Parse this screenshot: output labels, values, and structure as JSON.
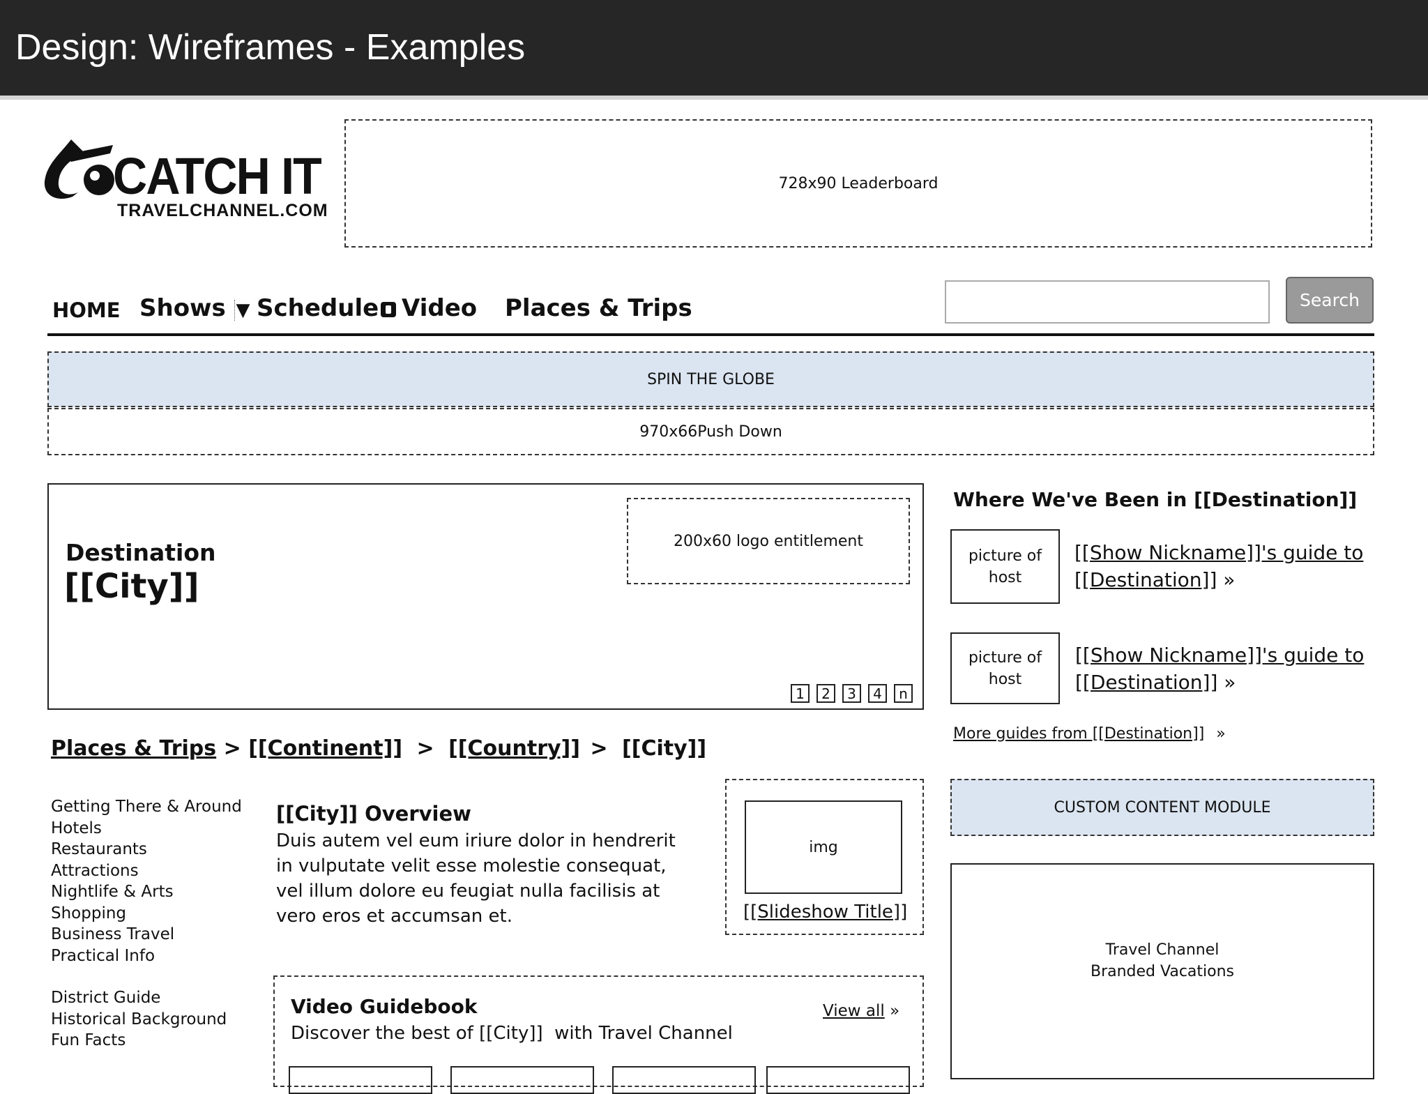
{
  "slide": {
    "title": "Design: Wireframes - Examples"
  },
  "brand": {
    "name": "CATCH IT",
    "domain": "TRAVELCHANNEL.COM"
  },
  "ads": {
    "leaderboard": "728x90 Leaderboard",
    "pushdown": "970x66Push Down",
    "logo_entitlement": "200x60 logo entitlement"
  },
  "nav": {
    "home": "HOME",
    "shows": "Shows",
    "schedule": "Schedule",
    "video": "Video",
    "places": "Places & Trips",
    "search_button": "Search",
    "search_value": ""
  },
  "spin_globe": "SPIN THE GLOBE",
  "hero": {
    "label": "Destination",
    "city": "[[City]]",
    "pages": [
      "1",
      "2",
      "3",
      "4",
      "n"
    ]
  },
  "breadcrumb": {
    "places": "Places & Trips",
    "continent": "[[Continent]]",
    "country": "[[Country]]",
    "city": "[[City]]",
    "sep1": ">",
    "sep2": ">",
    "sep3": ">"
  },
  "side_links": {
    "group1": [
      "Getting There & Around",
      "Hotels",
      "Restaurants",
      "Attractions",
      "Nightlife & Arts",
      "Shopping",
      "Business Travel",
      "Practical Info"
    ],
    "group2": [
      "District Guide",
      "Historical Background",
      "Fun Facts"
    ]
  },
  "overview": {
    "title": "[[City]] Overview",
    "body": "Duis autem vel eum iriure dolor in hendrerit in vulputate velit esse molestie consequat, vel illum dolore eu feugiat nulla facilisis at vero eros et accumsan et."
  },
  "slideshow": {
    "img": "img",
    "title": "[[Slideshow Title]]"
  },
  "video_guidebook": {
    "title": "Video Guidebook",
    "subtitle": "Discover the best of [[City]]  with Travel Channel",
    "view_all": "View all",
    "view_all_arrow": "»"
  },
  "where_been": {
    "heading": "Where We've Been in [[Destination]]",
    "items": [
      {
        "pic_line1": "picture of",
        "pic_line2": "host",
        "link1": "[[Show Nickname]]'s guide to",
        "link2": "[[Destination]]",
        "arrow": "»"
      },
      {
        "pic_line1": "picture of",
        "pic_line2": "host",
        "link1": "[[Show Nickname]]'s guide to",
        "link2": "[[Destination]]",
        "arrow": "»"
      }
    ],
    "more": "More guides from [[Destination]]",
    "more_arrow": "»"
  },
  "custom_module": "CUSTOM CONTENT MODULE",
  "branded": {
    "line1": "Travel Channel",
    "line2": "Branded Vacations"
  },
  "colors": {
    "titlebar": "#262626",
    "light_blue": "#dbe5f1",
    "search_button": "#9a9a9a"
  }
}
